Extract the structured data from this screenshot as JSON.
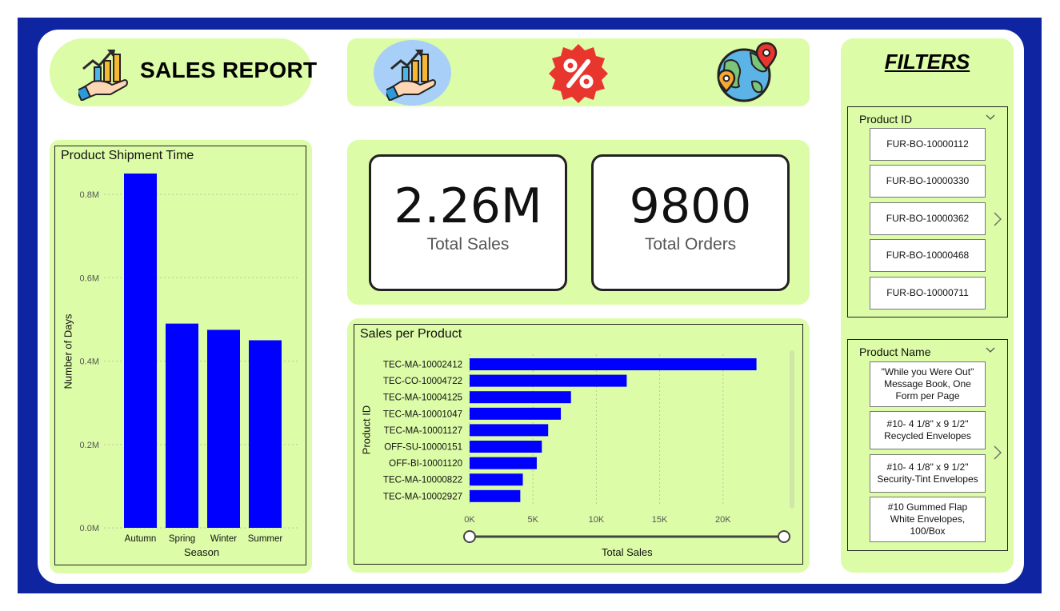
{
  "header": {
    "title": "SALES REPORT"
  },
  "icons": [
    "sales-growth-icon",
    "percent-badge-icon",
    "globe-location-icon"
  ],
  "shipment_chart": {
    "title": "Product Shipment Time",
    "xlabel": "Season",
    "ylabel": "Number of Days",
    "y_ticks": [
      "0.0M",
      "0.2M",
      "0.4M",
      "0.6M",
      "0.8M"
    ],
    "bar_color": "#0000ff"
  },
  "kpis": {
    "total_sales": {
      "value": "2.26M",
      "label": "Total Sales"
    },
    "total_orders": {
      "value": "9800",
      "label": "Total Orders"
    }
  },
  "sales_chart": {
    "title": "Sales per Product",
    "xlabel": "Total Sales",
    "ylabel": "Product ID",
    "x_ticks": [
      "0K",
      "5K",
      "10K",
      "15K",
      "20K"
    ],
    "bar_color": "#0000ff"
  },
  "filters": {
    "title": "FILTERS",
    "product_id": {
      "label": "Product ID",
      "items": [
        "FUR-BO-10000112",
        "FUR-BO-10000330",
        "FUR-BO-10000362",
        "FUR-BO-10000468",
        "FUR-BO-10000711"
      ]
    },
    "product_name": {
      "label": "Product Name",
      "items": [
        "\"While you Were Out\" Message Book, One Form per Page",
        "#10- 4 1/8\" x 9 1/2\" Recycled Envelopes",
        "#10- 4 1/8\" x 9 1/2\" Security-Tint Envelopes",
        "#10 Gummed Flap White Envelopes, 100/Box"
      ]
    }
  },
  "chart_data": [
    {
      "type": "bar",
      "title": "Product Shipment Time",
      "xlabel": "Season",
      "ylabel": "Number of Days",
      "categories": [
        "Autumn",
        "Spring",
        "Winter",
        "Summer"
      ],
      "values": [
        850000,
        490000,
        475000,
        450000
      ],
      "ylim": [
        0,
        850000
      ],
      "grid": true
    },
    {
      "type": "bar",
      "orientation": "horizontal",
      "title": "Sales per Product",
      "xlabel": "Total Sales",
      "ylabel": "Product ID",
      "categories": [
        "TEC-MA-10002412",
        "TEC-CO-10004722",
        "TEC-MA-10004125",
        "TEC-MA-10001047",
        "TEC-MA-10001127",
        "OFF-SU-10000151",
        "OFF-BI-10001120",
        "TEC-MA-10000822",
        "TEC-MA-10002927"
      ],
      "values": [
        22638,
        12400,
        8000,
        7200,
        6200,
        5700,
        5300,
        4200,
        4000
      ],
      "xlim": [
        0,
        25000
      ],
      "grid": true
    }
  ]
}
